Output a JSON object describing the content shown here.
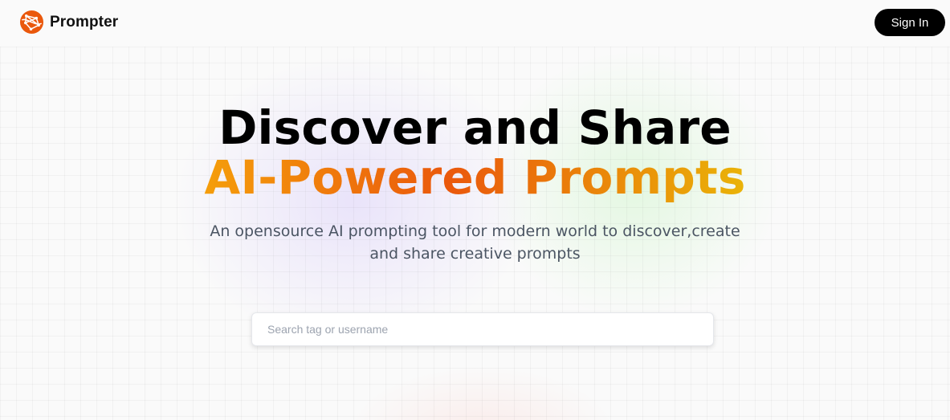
{
  "header": {
    "brand_name": "Prompter",
    "brand_logo_icon": "globe-network-icon",
    "brand_color": "#ea580c",
    "signin_label": "Sign In"
  },
  "hero": {
    "headline_line1": "Discover and Share",
    "headline_line2": "AI-Powered Prompts",
    "accent_gradient": [
      "#f59e0b",
      "#ea580c",
      "#eab308"
    ],
    "subtitle": "An opensource AI prompting tool for modern world to discover,create and share creative prompts"
  },
  "search": {
    "placeholder": "Search tag or username",
    "value": ""
  }
}
